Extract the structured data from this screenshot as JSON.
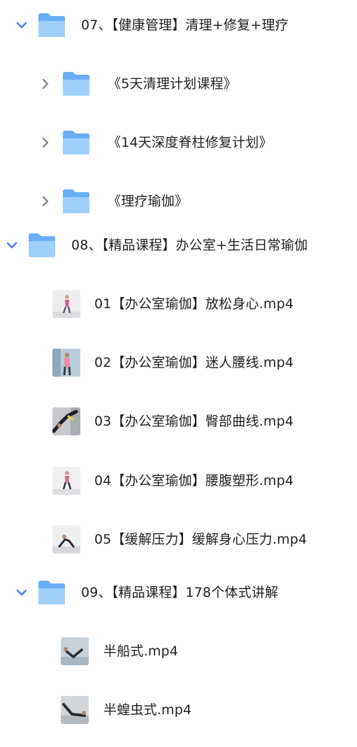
{
  "colors": {
    "accent": "#4f7ff2",
    "folder_back": "#6aaef7",
    "folder_front": "#9fd0fb",
    "chevron_gray": "#7a7a7a",
    "text": "#1f1f1f"
  },
  "tree": [
    {
      "label": "07、【健康管理】清理+修复+理疗",
      "icon": "folder-icon",
      "state": "expanded"
    },
    {
      "label": "《5天清理计划课程》",
      "icon": "folder-icon",
      "state": "collapsed"
    },
    {
      "label": "《14天深度脊柱修复计划》",
      "icon": "folder-icon",
      "state": "collapsed"
    },
    {
      "label": "《理疗瑜伽》",
      "icon": "folder-icon",
      "state": "collapsed"
    },
    {
      "label": "08、【精品课程】办公室+生活日常瑜伽",
      "icon": "folder-icon",
      "state": "expanded"
    },
    {
      "label": "01【办公室瑜伽】放松身心.mp4",
      "icon": "video-thumbnail-icon"
    },
    {
      "label": "02【办公室瑜伽】迷人腰线.mp4",
      "icon": "video-thumbnail-icon"
    },
    {
      "label": "03【办公室瑜伽】臀部曲线.mp4",
      "icon": "video-thumbnail-icon"
    },
    {
      "label": "04【办公室瑜伽】腰腹塑形.mp4",
      "icon": "video-thumbnail-icon"
    },
    {
      "label": "05【缓解压力】缓解身心压力.mp4",
      "icon": "video-thumbnail-icon"
    },
    {
      "label": "09、【精品课程】178个体式讲解",
      "icon": "folder-icon",
      "state": "expanded"
    },
    {
      "label": "半船式.mp4",
      "icon": "video-thumbnail-icon"
    },
    {
      "label": "半蝗虫式.mp4",
      "icon": "video-thumbnail-icon"
    }
  ]
}
